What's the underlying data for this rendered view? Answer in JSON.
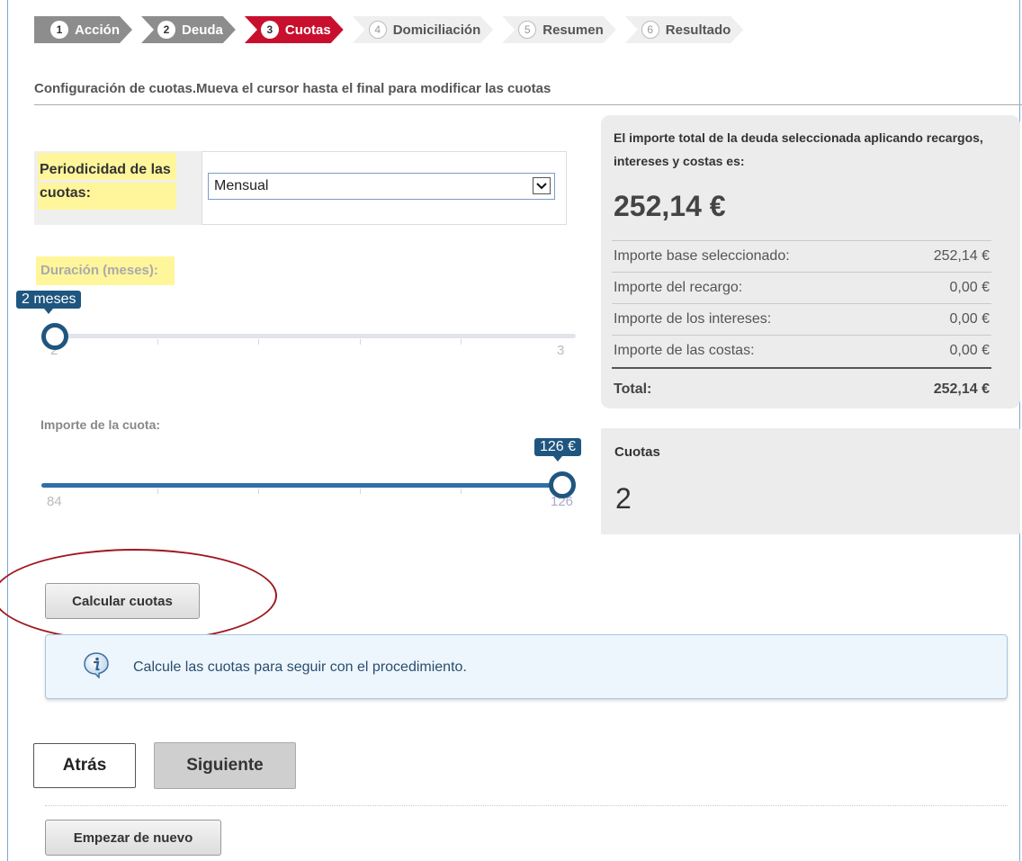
{
  "steps": [
    {
      "num": "1",
      "label": "Acción",
      "state": "done"
    },
    {
      "num": "2",
      "label": "Deuda",
      "state": "done"
    },
    {
      "num": "3",
      "label": "Cuotas",
      "state": "active"
    },
    {
      "num": "4",
      "label": "Domiciliación",
      "state": "todo"
    },
    {
      "num": "5",
      "label": "Resumen",
      "state": "todo"
    },
    {
      "num": "6",
      "label": "Resultado",
      "state": "todo"
    }
  ],
  "section_title": "Configuración de cuotas.Mueva el cursor hasta el final para modificar las cuotas",
  "periodicidad": {
    "label": "Periodicidad de las cuotas:",
    "selected": "Mensual"
  },
  "duracion": {
    "label": "Duración (meses):",
    "tooltip": "2 meses",
    "min": "2",
    "max": "3",
    "value": 2
  },
  "importe_cuota": {
    "label": "Importe de la cuota:",
    "tooltip": "126 €",
    "min": "84",
    "max": "126",
    "value": 126
  },
  "summary": {
    "intro": "El importe total de la deuda seleccionada aplicando recargos, intereses y costas es:",
    "total_big": "252,14 €",
    "rows": [
      {
        "label": "Importe base seleccionado:",
        "value": "252,14 €"
      },
      {
        "label": "Importe del recargo:",
        "value": "0,00 €"
      },
      {
        "label": "Importe de los intereses:",
        "value": "0,00 €"
      },
      {
        "label": "Importe de las costas:",
        "value": "0,00 €"
      }
    ],
    "total_label": "Total:",
    "total_value": "252,14 €"
  },
  "cuotas": {
    "title": "Cuotas",
    "value": "2"
  },
  "buttons": {
    "calcular": "Calcular cuotas",
    "atras": "Atrás",
    "siguiente": "Siguiente",
    "empezar": "Empezar de nuevo"
  },
  "info_message": "Calcule las cuotas para seguir con el procedimiento.",
  "colors": {
    "active_step": "#c8102e",
    "slider": "#1f5680",
    "highlight": "#fff69b",
    "annotation": "#a0161e"
  }
}
